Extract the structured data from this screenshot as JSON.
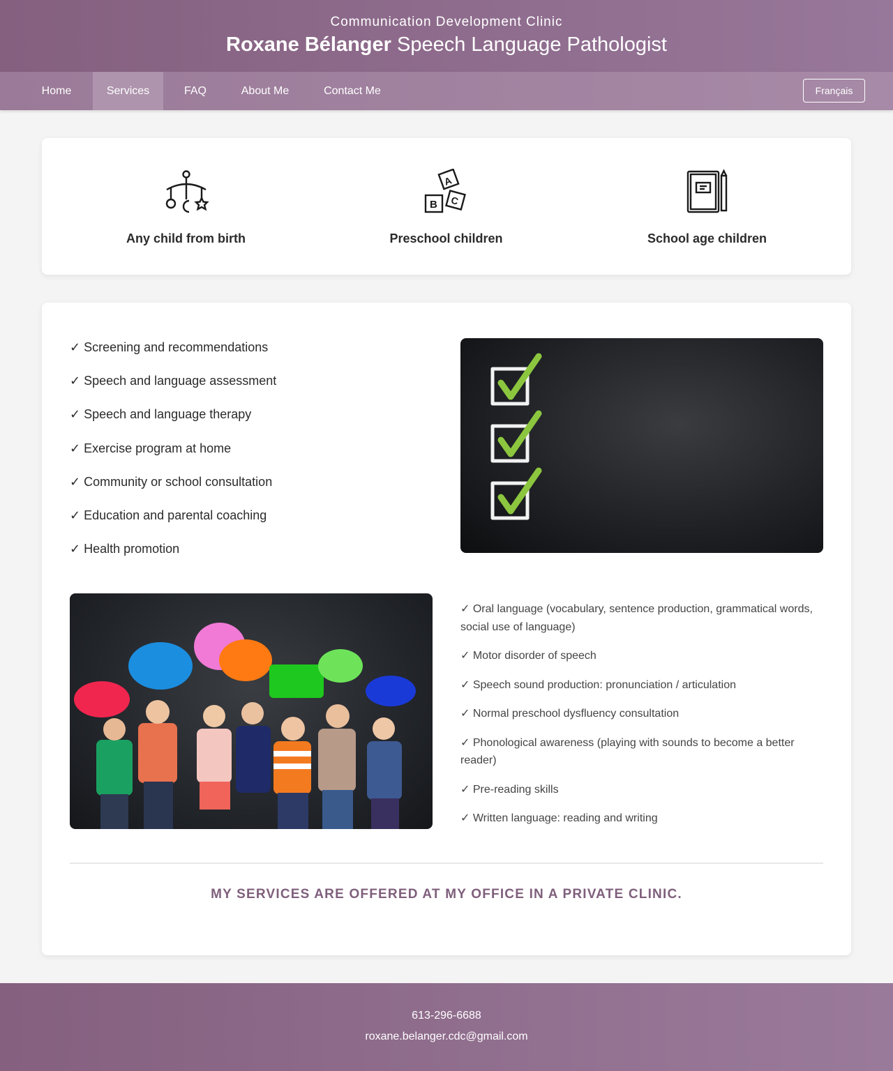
{
  "header": {
    "clinic_name": "Communication Development Clinic",
    "title_name": "Roxane Bélanger",
    "title_role": "Speech Language Pathologist"
  },
  "nav": {
    "items": [
      {
        "label": "Home",
        "active": false
      },
      {
        "label": "Services",
        "active": true
      },
      {
        "label": "FAQ",
        "active": false
      },
      {
        "label": "About Me",
        "active": false
      },
      {
        "label": "Contact Me",
        "active": false
      }
    ],
    "language_button": "Français"
  },
  "age_groups": [
    {
      "label": "Any child from birth",
      "icon": "baby-mobile-icon"
    },
    {
      "label": "Preschool children",
      "icon": "abc-blocks-icon"
    },
    {
      "label": "School age children",
      "icon": "book-pencil-icon"
    }
  ],
  "services": [
    "✓ Screening and recommendations",
    "✓ Speech and language assessment",
    "✓ Speech and language therapy",
    "✓ Exercise program at home",
    "✓ Community or school consultation",
    "✓ Education and parental coaching",
    "✓ Health promotion"
  ],
  "language_areas": [
    "✓ Oral language (vocabulary, sentence production, grammatical words, social use of language)",
    "✓ Motor disorder of speech",
    "✓ Speech sound production: pronunciation / articulation",
    "✓ Normal preschool dysfluency consultation",
    "✓ Phonological awareness (playing with sounds to become a better reader)",
    "✓ Pre-reading skills",
    "✓ Written language: reading and writing"
  ],
  "office_note": "MY SERVICES ARE OFFERED AT MY OFFICE IN A PRIVATE CLINIC.",
  "footer": {
    "phone": "613-296-6688",
    "email": "roxane.belanger.cdc@gmail.com"
  },
  "colors": {
    "brand_purple": "#85607f",
    "nav_active": "#ae94ad",
    "accent_heading": "#7f5f7c",
    "check_green": "#8cc63f"
  }
}
